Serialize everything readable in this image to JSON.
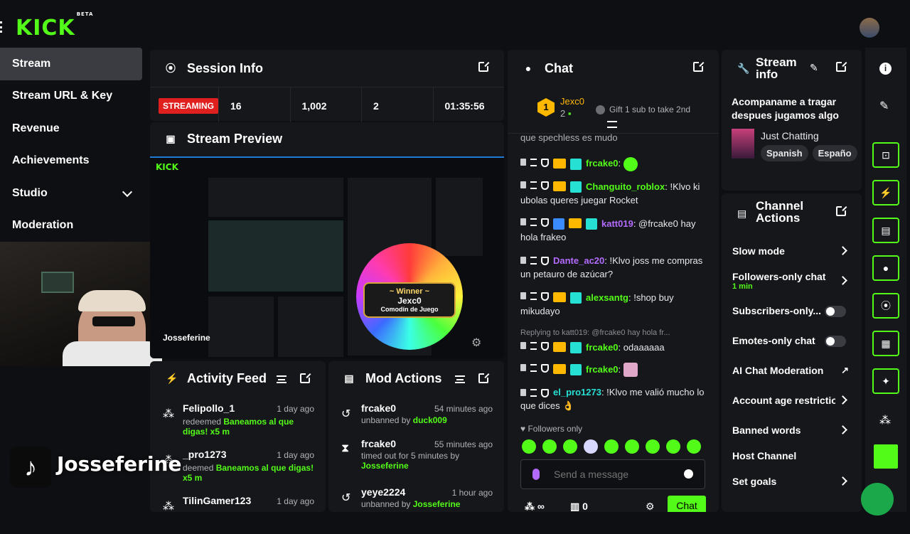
{
  "app": {
    "logo": "KICK",
    "logo_badge": "BETA"
  },
  "sidebar": {
    "items": [
      {
        "label": "Stream"
      },
      {
        "label": "Stream URL & Key"
      },
      {
        "label": "Revenue"
      },
      {
        "label": "Achievements"
      },
      {
        "label": "Studio"
      },
      {
        "label": "Moderation"
      }
    ]
  },
  "session": {
    "title": "Session Info",
    "status": "STREAMING",
    "viewers": "16",
    "followers": "1,002",
    "subs": "2",
    "duration": "01:35:56"
  },
  "preview": {
    "title": "Stream Preview",
    "streamer_overlay": "Josseferine",
    "winner_label": "~ Winner ~",
    "winner_name": "Jexc0",
    "winner_sub": "Comodín de Juego"
  },
  "activity": {
    "title": "Activity Feed",
    "items": [
      {
        "name": "Felipollo_1",
        "time": "1 day ago",
        "action": "redeemed",
        "reward": "Baneamos al que digas! x5 m"
      },
      {
        "name": "_pro1273",
        "time": "1 day ago",
        "action": "deemed",
        "reward": "Baneamos al que digas! x5 m"
      },
      {
        "name": "TilinGamer123",
        "time": "1 day ago",
        "action": "",
        "reward": ""
      }
    ]
  },
  "mod": {
    "title": "Mod Actions",
    "items": [
      {
        "name": "frcake0",
        "time": "54 minutes ago",
        "text": "unbanned by",
        "by": "duck009"
      },
      {
        "name": "frcake0",
        "time": "55 minutes ago",
        "text": "timed out for 5 minutes by",
        "by": "Josseferine"
      },
      {
        "name": "yeye2224",
        "time": "1 hour ago",
        "text": "unbanned by",
        "by": "Josseferine"
      }
    ]
  },
  "chat": {
    "title": "Chat",
    "top_gifter": "Jexc0",
    "top_gifter_count": "2",
    "gift_hint": "Gift 1 sub to take 2nd",
    "partial_line": "que spechless es mudo",
    "messages": [
      {
        "user": "frcake0",
        "color": "#53fc18",
        "text": ""
      },
      {
        "user": "Changuito_roblox",
        "color": "#53fc18",
        "text": "!Klvo ki ubolas queres juegar Rocket"
      },
      {
        "user": "katt019",
        "color": "#b36bff",
        "text": "@frcake0 hay hola frakeo"
      },
      {
        "user": "Dante_ac20",
        "color": "#b36bff",
        "text": "!Klvo joss me compras un petauro de azúcar?"
      },
      {
        "user": "alexsantg",
        "color": "#53fc18",
        "text": "!shop buy mikudayo"
      },
      {
        "user": "frcake0",
        "color": "#53fc18",
        "text": "odaaaaaa"
      },
      {
        "user": "frcake0",
        "color": "#53fc18",
        "text": ""
      },
      {
        "user": "el_pro1273",
        "color": "#27e0d4",
        "text": "!Klvo me valió mucho lo que dices 👌"
      }
    ],
    "reply_hint": "Replying to katt019: @frcake0 hay hola fr...",
    "followers_only": "Followers only",
    "input_placeholder": "Send a message",
    "points": "∞",
    "gift_count": "0",
    "send_label": "Chat"
  },
  "stream_info": {
    "title": "Stream info",
    "stream_title": "Acompaname a tragar despues jugamos algo",
    "category": "Just Chatting",
    "tags": [
      "Spanish",
      "Españo"
    ]
  },
  "channel_actions": {
    "title": "Channel Actions",
    "items": [
      {
        "label": "Slow mode",
        "sub": ""
      },
      {
        "label": "Followers-only chat",
        "sub": "1 min"
      },
      {
        "label": "Subscribers-only...",
        "sub": ""
      },
      {
        "label": "Emotes-only chat",
        "sub": ""
      },
      {
        "label": "AI Chat Moderation",
        "sub": ""
      },
      {
        "label": "Account age restrictio",
        "sub": ""
      },
      {
        "label": "Banned words",
        "sub": ""
      },
      {
        "label": "Host Channel",
        "sub": ""
      },
      {
        "label": "Set goals",
        "sub": ""
      }
    ]
  },
  "overlay": {
    "tiktok_name": "Josseferine"
  },
  "colors": {
    "accent": "#53fc18",
    "live": "#e01f1f",
    "panel": "#16171b",
    "bg": "#0e0f12"
  }
}
